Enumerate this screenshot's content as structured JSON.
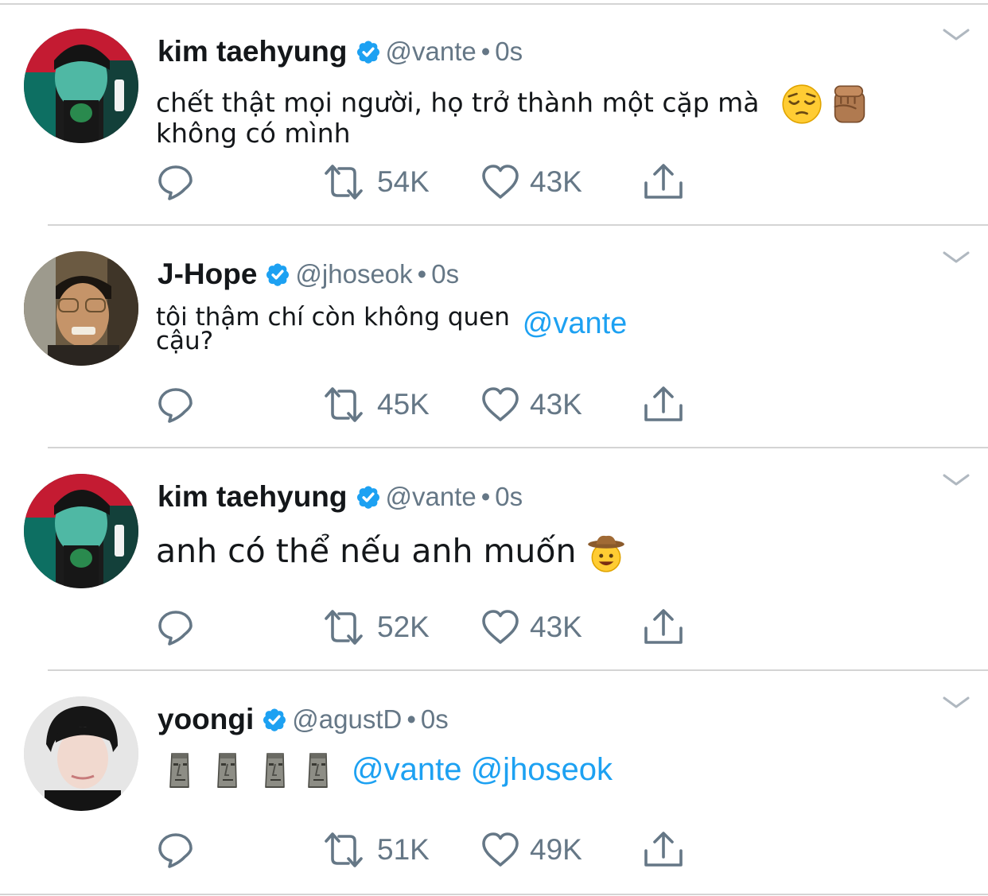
{
  "tweets": [
    {
      "name": "kim taehyung",
      "handle": "@vante",
      "dot": "•",
      "time": "0s",
      "avatar": "taehyung-avatar",
      "text_line1": "chết thật mọi người, họ trở thành một cặp mà",
      "text_line2": "không có mình",
      "emojis": [
        "pensive-face-emoji",
        "raised-fist-emoji"
      ],
      "retweets": "54K",
      "likes": "43K"
    },
    {
      "name": "J-Hope",
      "handle": "@jhoseok",
      "dot": "•",
      "time": "0s",
      "avatar": "jhope-avatar",
      "text_line1": "tôi thậm chí còn không quen",
      "mention": "@vante",
      "text_line2": "cậu?",
      "retweets": "45K",
      "likes": "43K"
    },
    {
      "name": "kim taehyung",
      "handle": "@vante",
      "dot": "•",
      "time": "0s",
      "avatar": "taehyung-avatar",
      "text_line1": "anh có thể nếu anh muốn",
      "emojis": [
        "cowboy-face-emoji"
      ],
      "retweets": "52K",
      "likes": "43K"
    },
    {
      "name": "yoongi",
      "handle": "@agustD",
      "dot": "•",
      "time": "0s",
      "avatar": "yoongi-avatar",
      "emojis": [
        "moai-emoji",
        "moai-emoji",
        "moai-emoji",
        "moai-emoji"
      ],
      "mentions": "@vante @jhoseok",
      "retweets": "51K",
      "likes": "49K"
    }
  ],
  "colors": {
    "text": "#14171a",
    "secondary": "#657786",
    "link": "#1da1f2",
    "verified": "#1da1f2",
    "divider": "#d4d4d4"
  }
}
